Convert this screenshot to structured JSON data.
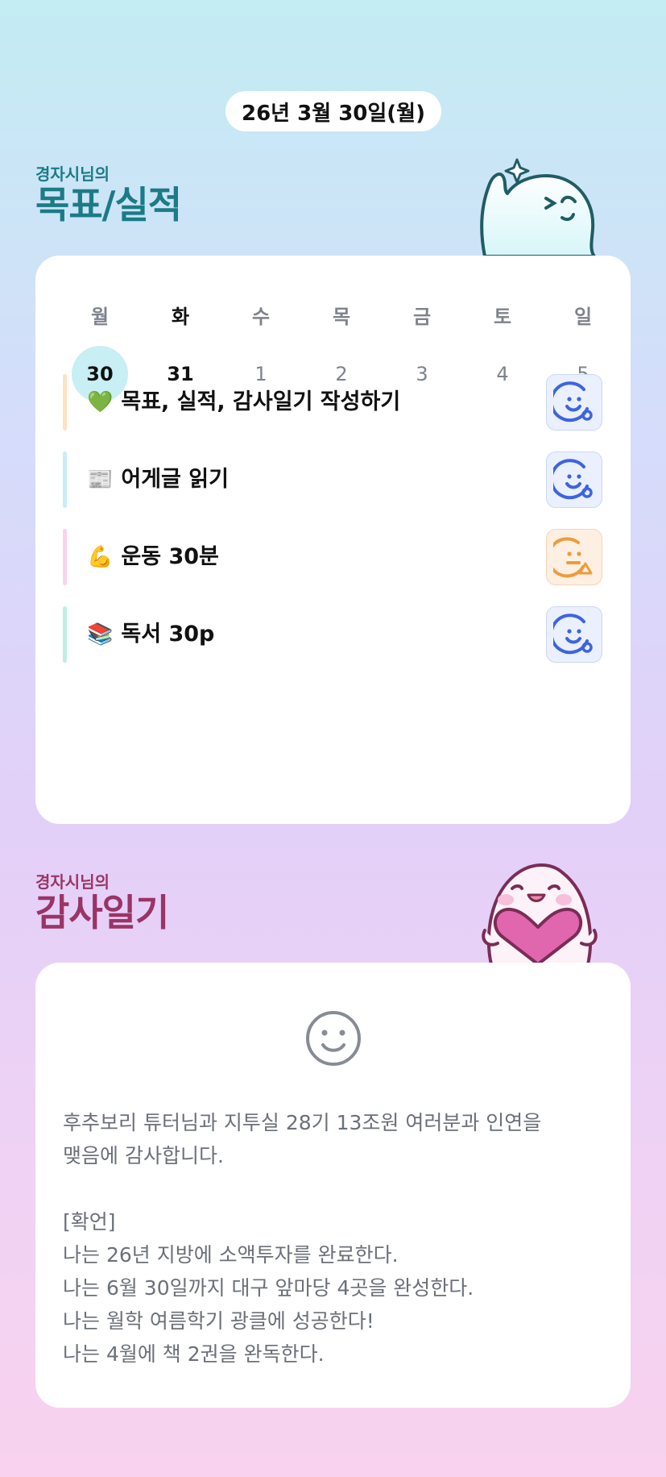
{
  "header": {
    "date": "26년 3월 30일(월)"
  },
  "goals_section": {
    "subtitle": "경자시님의",
    "title": "목표/실적",
    "weekdays": [
      "월",
      "화",
      "수",
      "목",
      "금",
      "토",
      "일"
    ],
    "days": [
      "30",
      "31",
      "1",
      "2",
      "3",
      "4",
      "5"
    ],
    "selected_day": "30",
    "tasks": [
      {
        "emoji": "💚",
        "label": "목표, 실적, 감사일기 작성하기",
        "bar_color": "#fde3bf",
        "status": "blue"
      },
      {
        "emoji": "📰",
        "label": "어게글 읽기",
        "bar_color": "#c6eef4",
        "status": "blue"
      },
      {
        "emoji": "💪",
        "label": "운동 30분",
        "bar_color": "#fbd2ec",
        "status": "orange"
      },
      {
        "emoji": "📚",
        "label": "독서 30p",
        "bar_color": "#bff0dd",
        "status": "blue"
      }
    ]
  },
  "diary_section": {
    "subtitle": "경자시님의",
    "title": "감사일기",
    "text": "후추보리 튜터님과 지투실 28기 13조원 여러분과 인연을\n맺음에 감사합니다.\n\n[확언]\n나는 26년 지방에 소액투자를 완료한다.\n나는 6월 30일까지 대구 앞마당 4곳을 완성한다.\n나는 월학 여름학기 광클에 성공한다!\n나는 4월에 책 2권을 완독한다."
  },
  "colors": {
    "accent_teal": "#1b7b86",
    "accent_plum": "#9a3466",
    "status_blue": "#3d64e0",
    "status_orange": "#f09a3a"
  }
}
